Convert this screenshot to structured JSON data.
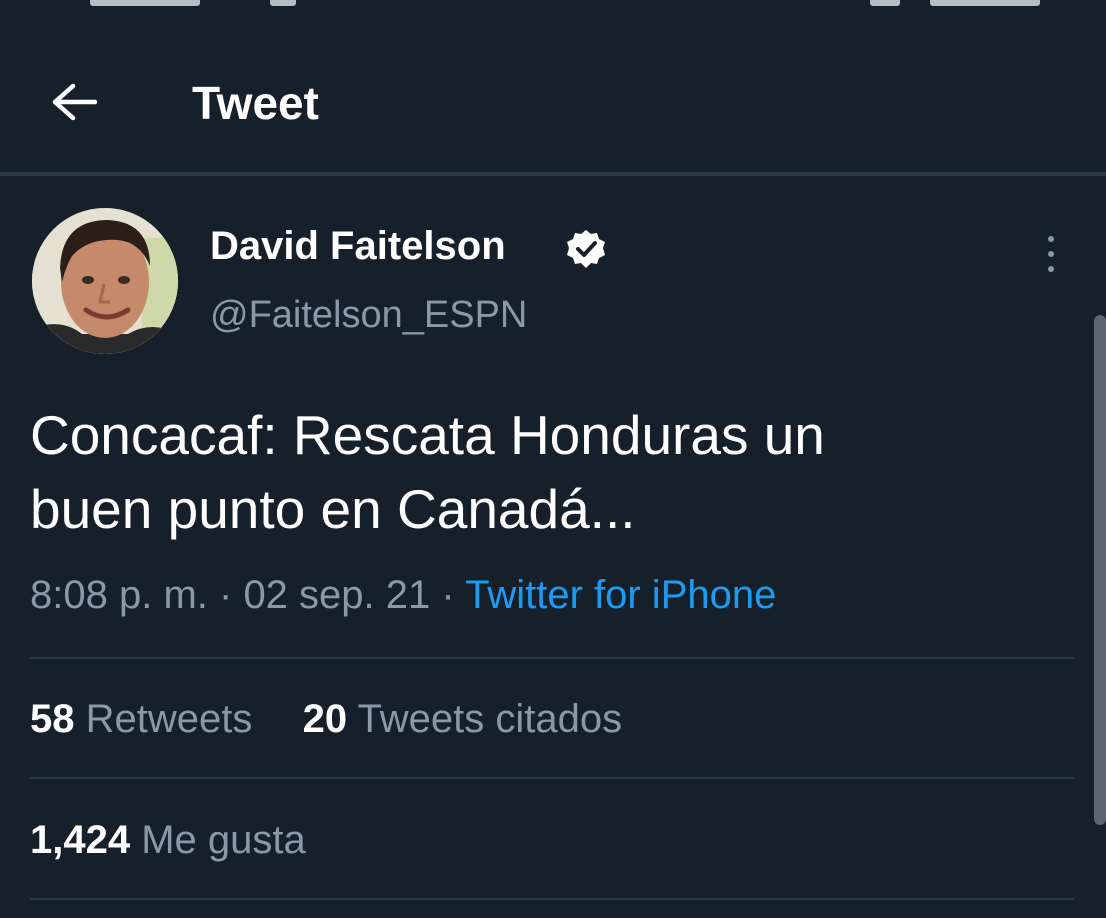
{
  "header": {
    "title": "Tweet",
    "back_icon": "arrow-left-icon"
  },
  "tweet": {
    "author_name": "David Faitelson",
    "author_handle": "@Faitelson_ESPN",
    "verified_icon": "verified-badge-icon",
    "more_icon": "more-vertical-icon",
    "text_line1": "Concacaf: Rescata Honduras un",
    "text_line2": "buen punto en Canadá...",
    "time": "8:08 p. m.",
    "date": "02 sep. 21",
    "source": "Twitter for iPhone"
  },
  "stats": {
    "retweets_count": "58",
    "retweets_label": "Retweets",
    "quotes_count": "20",
    "quotes_label": "Tweets citados",
    "likes_count": "1,424",
    "likes_label": "Me gusta"
  },
  "colors": {
    "background": "#16202b",
    "accent": "#1d9bf0",
    "secondary_text": "#8b98a5"
  }
}
